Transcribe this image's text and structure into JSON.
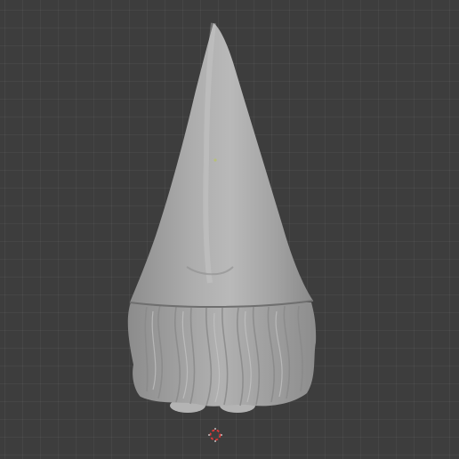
{
  "viewport": {
    "background": "#3d3d3d",
    "grid_color": "#474747"
  },
  "object": {
    "name_hint": "gnome-model",
    "material_color": "#a9a9a9",
    "shadow_color": "#6f6f6f"
  },
  "icons": {
    "origin": "object-origin-icon",
    "cursor": "3d-cursor-icon"
  },
  "colors": {
    "cursor_red": "#e03a3a",
    "cursor_white": "#ffffff",
    "origin": "#b7c07a"
  }
}
